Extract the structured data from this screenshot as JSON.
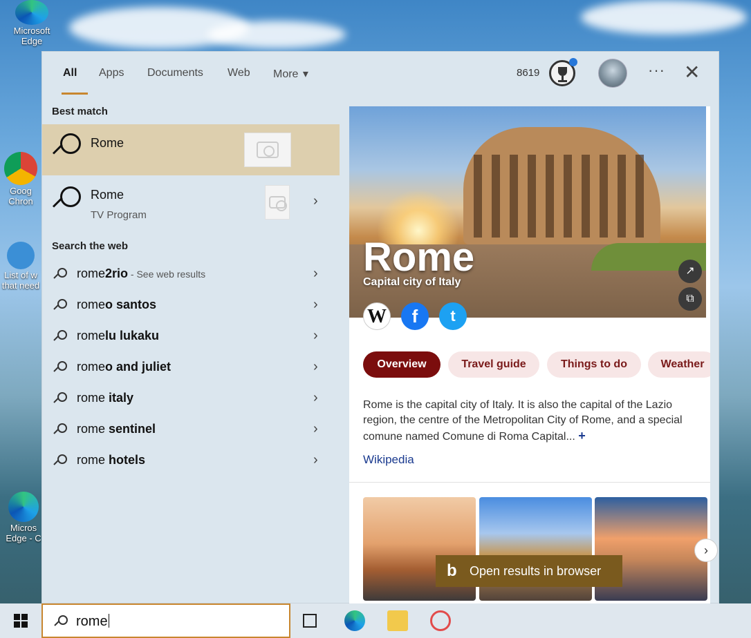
{
  "desktop": {
    "icons": [
      {
        "label": "Microsoft Edge"
      },
      {
        "label": "Goog Chron"
      },
      {
        "label": "List of w that need"
      },
      {
        "label": "Micros Edge - C"
      }
    ]
  },
  "search_panel": {
    "tabs": [
      {
        "label": "All",
        "active": true
      },
      {
        "label": "Apps"
      },
      {
        "label": "Documents"
      },
      {
        "label": "Web"
      },
      {
        "label": "More"
      }
    ],
    "more_caret": "▾",
    "points": "8619",
    "more_options": "···",
    "close": "✕",
    "best_match_label": "Best match",
    "best_match": [
      {
        "title": "Rome",
        "subtitle": "",
        "selected": true
      },
      {
        "title": "Rome",
        "subtitle": "TV Program",
        "selected": false
      }
    ],
    "search_web_label": "Search the web",
    "web_results": [
      {
        "prefix": "rome",
        "suffix": "2rio",
        "hint": " - See web results"
      },
      {
        "prefix": "rome",
        "suffix": "o santos",
        "hint": ""
      },
      {
        "prefix": "rome",
        "suffix": "lu lukaku",
        "hint": ""
      },
      {
        "prefix": "rome",
        "suffix": "o and juliet",
        "hint": ""
      },
      {
        "prefix": "rome",
        "suffix": " italy",
        "hint": ""
      },
      {
        "prefix": "rome",
        "suffix": " sentinel",
        "hint": ""
      },
      {
        "prefix": "rome",
        "suffix": " hotels",
        "hint": ""
      }
    ],
    "chevron": "›"
  },
  "detail": {
    "title": "Rome",
    "subtitle": "Capital city of Italy",
    "social": {
      "wiki": "W",
      "facebook": "f",
      "twitter": "t"
    },
    "share_icon": "↗",
    "expand_icon": "⧉",
    "pills": [
      {
        "label": "Overview",
        "active": true
      },
      {
        "label": "Travel guide"
      },
      {
        "label": "Things to do"
      },
      {
        "label": "Weather"
      }
    ],
    "description": "Rome is the capital city of Italy. It is also the capital of the Lazio region, the centre of the Metropolitan City of Rome, and a special comune named Comune di Roma Capital...",
    "more": "+",
    "source_link": "Wikipedia",
    "next": "›",
    "open_browser": "Open results in browser",
    "bing": "b"
  },
  "taskbar": {
    "query": "rome"
  }
}
